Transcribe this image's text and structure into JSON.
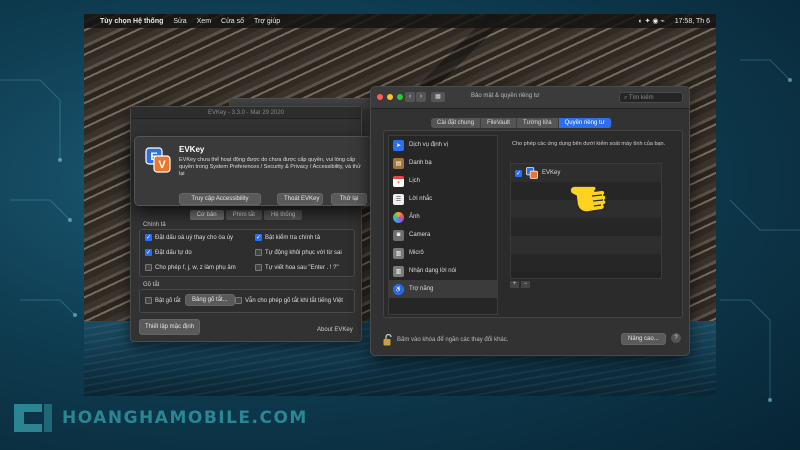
{
  "menubar": {
    "app_name": "Tùy chọn Hệ thống",
    "items": [
      "Sửa",
      "Xem",
      "Cửa sổ",
      "Trợ giúp"
    ],
    "clock": "17:58, Th 6"
  },
  "evkey_window": {
    "title": "EVKey - 3.3.0 - Mar 29 2020",
    "tabs": [
      "Cơ bản",
      "Phím tắt",
      "Hệ thống"
    ],
    "active_tab": 0,
    "group1_label": "Chính tả",
    "checks": [
      {
        "label": "Đặt dấu oà uý thay cho òa úy",
        "checked": true
      },
      {
        "label": "Bật kiểm tra chính tả",
        "checked": true
      },
      {
        "label": "Đặt dấu tự do",
        "checked": true
      },
      {
        "label": "Tự động khôi phục với từ sai",
        "checked": false
      },
      {
        "label": "Cho phép f, j, w, z làm phụ âm",
        "checked": false
      },
      {
        "label": "Tự viết hoa sau \"Enter . ! ?\"",
        "checked": false
      }
    ],
    "group2_label": "Gõ tắt",
    "shortcut_check": {
      "label": "Bật gõ tắt",
      "checked": false
    },
    "shortcut_table_button": "Bảng gõ tắt...",
    "shortcut_noenglish": {
      "label": "Vẫn cho phép gõ tắt khi tắt tiếng Việt",
      "checked": false
    },
    "defaults_button": "Thiết lập mặc định",
    "about_link": "About EVKey"
  },
  "alert": {
    "title": "EVKey",
    "message": "EVKey chưa thể hoạt động được do chưa được cấp quyền, vui lòng cấp quyền trong System Preferences / Security & Privacy / Accessibility, và thử lại",
    "buttons": [
      "Truy cập Accessibility",
      "Thoát EVKey",
      "Thử lại"
    ]
  },
  "security_window": {
    "title": "Bảo mật & quyền riêng tư",
    "search_placeholder": "Tìm kiếm",
    "tabs": [
      "Cài đặt chung",
      "FileVault",
      "Tường lửa",
      "Quyền riêng tư"
    ],
    "active_tab": 3,
    "sidebar": [
      {
        "label": "Dịch vụ định vị",
        "icon": "location-icon",
        "color": "#2b6ef2"
      },
      {
        "label": "Danh bạ",
        "icon": "contacts-icon",
        "color": "#a0753f"
      },
      {
        "label": "Lịch",
        "icon": "calendar-icon",
        "color": "#e8483f"
      },
      {
        "label": "Lời nhắc",
        "icon": "reminders-icon",
        "color": "#eeeeee"
      },
      {
        "label": "Ảnh",
        "icon": "photos-icon",
        "color": "#f2a33a"
      },
      {
        "label": "Camera",
        "icon": "camera-icon",
        "color": "#6e6e6e"
      },
      {
        "label": "Micrô",
        "icon": "microphone-icon",
        "color": "#7a7a7a"
      },
      {
        "label": "Nhận dạng lời nói",
        "icon": "speech-icon",
        "color": "#7a7a7a"
      },
      {
        "label": "Trợ năng",
        "icon": "accessibility-icon",
        "color": "#2b6ef2"
      }
    ],
    "active_sidebar": 8,
    "description": "Cho phép các ứng dụng bên dưới kiểm soát máy tính của bạn.",
    "apps": [
      {
        "name": "EVKey",
        "checked": true
      }
    ],
    "lock_text": "Bấm vào khóa để ngăn các thay đổi khác.",
    "advanced_button": "Nâng cao...",
    "help_button": "?"
  },
  "watermark": "HOANGHAMOBILE.COM",
  "colors": {
    "accent": "#2b6ef2",
    "traffic_red": "#ff5f57",
    "traffic_yellow": "#febc2e",
    "traffic_green": "#28c840"
  }
}
